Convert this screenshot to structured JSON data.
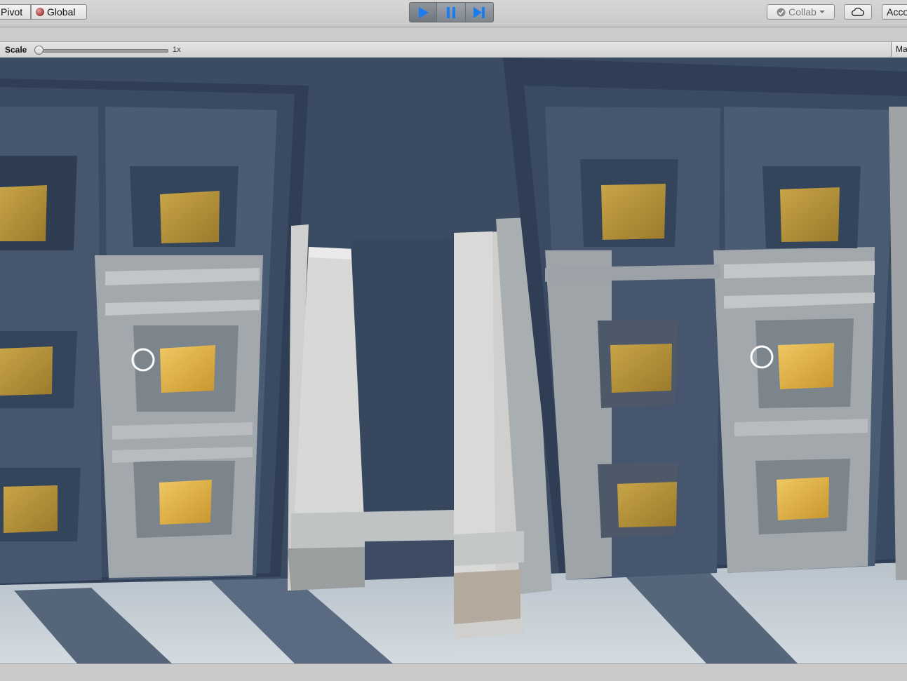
{
  "toolbar": {
    "pivot_label": "Pivot",
    "global_label": "Global",
    "collab_label": "Collab",
    "account_label": "Acco"
  },
  "game_view": {
    "scale_label": "Scale",
    "scale_value": "1x",
    "maximize_label": "Ma"
  },
  "colors": {
    "play_active": "#1a7cf0",
    "wall": "#3d4e66",
    "gold": "#e0b656",
    "marble": "#c7c9c9"
  }
}
